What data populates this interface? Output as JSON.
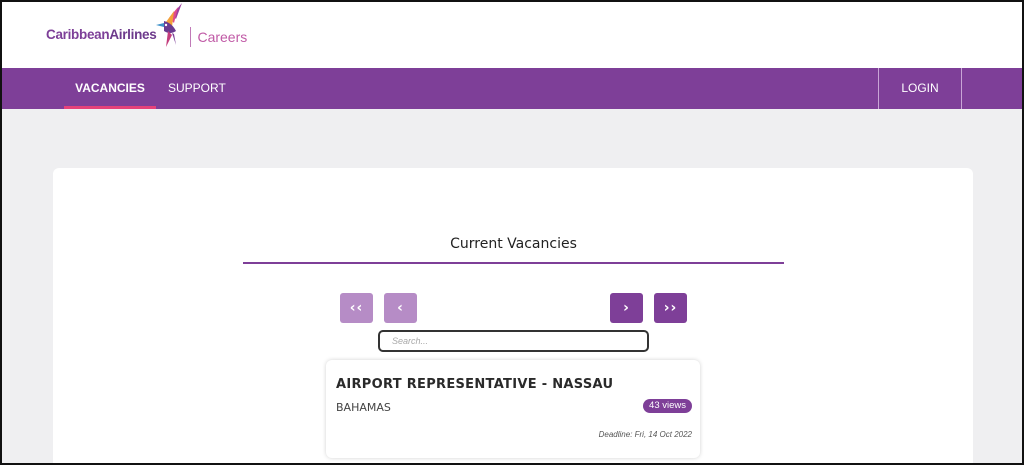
{
  "brand": {
    "name_part1": "Caribbean",
    "name_part2": "Airlines",
    "section": "Careers",
    "primary_color": "#7e3f98",
    "accent_color": "#e6427a"
  },
  "nav": {
    "items": [
      {
        "label": "VACANCIES",
        "active": true
      },
      {
        "label": "SUPPORT",
        "active": false
      }
    ],
    "login_label": "LOGIN"
  },
  "vacancies": {
    "title": "Current Vacancies",
    "pagination": {
      "first_icon": "double-chevron-left-icon",
      "prev_icon": "chevron-left-icon",
      "next_icon": "chevron-right-icon",
      "last_icon": "double-chevron-right-icon",
      "first_label": "‹‹",
      "prev_label": "‹",
      "next_label": "›",
      "last_label": "››"
    },
    "search": {
      "placeholder": "Search...",
      "value": ""
    },
    "jobs": [
      {
        "title": "AIRPORT REPRESENTATIVE - NASSAU",
        "country": "BAHAMAS",
        "views": "43 views",
        "deadline": "Deadline: Fri, 14 Oct 2022"
      }
    ]
  }
}
